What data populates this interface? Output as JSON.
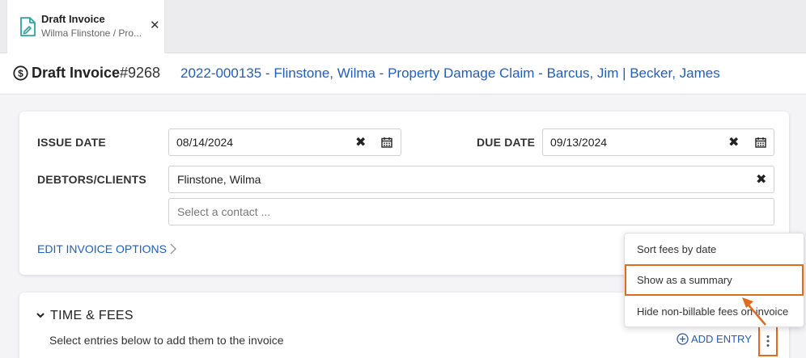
{
  "tab": {
    "title": "Draft Invoice",
    "subtitle": "Wilma Flinstone / Pro...",
    "close": "✕"
  },
  "header": {
    "title": "Draft Invoice",
    "number": "#9268",
    "matter": "2022-000135 - Flinstone, Wilma - Property Damage Claim - Barcus, Jim | Becker, James"
  },
  "form": {
    "issue_label": "ISSUE DATE",
    "issue_value": "08/14/2024",
    "due_label": "DUE DATE",
    "due_value": "09/13/2024",
    "debtors_label": "DEBTORS/CLIENTS",
    "debtor_value": "Flinstone, Wilma",
    "contact_placeholder": "Select a contact ...",
    "edit_options": "EDIT INVOICE OPTIONS",
    "clear_symbol": "✖"
  },
  "fees": {
    "title": "TIME & FEES",
    "subtitle": "Select entries below to add them to the invoice",
    "add_entry": "ADD ENTRY"
  },
  "menu": {
    "items": [
      {
        "label": "Sort fees by date"
      },
      {
        "label": "Show as a summary"
      },
      {
        "label": "Hide non-billable fees on invoice"
      }
    ]
  },
  "colors": {
    "accent": "#1f5fbf",
    "highlight": "#e06a1f",
    "icon_teal": "#2aa6a0"
  }
}
